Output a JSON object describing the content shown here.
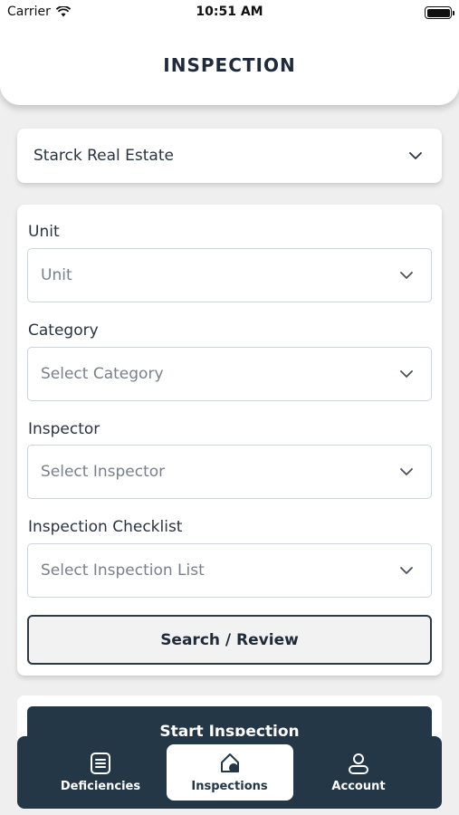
{
  "status_bar": {
    "carrier": "Carrier",
    "time": "10:51 AM"
  },
  "header": {
    "title": "INSPECTION"
  },
  "company_select": {
    "value": "Starck Real Estate"
  },
  "form": {
    "unit": {
      "label": "Unit",
      "placeholder": "Unit"
    },
    "category": {
      "label": "Category",
      "placeholder": "Select Category"
    },
    "inspector": {
      "label": "Inspector",
      "placeholder": "Select Inspector"
    },
    "checklist": {
      "label": "Inspection Checklist",
      "placeholder": "Select Inspection List"
    },
    "search_button": "Search / Review"
  },
  "start_button": "Start Inspection",
  "tabbar": {
    "items": [
      {
        "label": "Deficiencies",
        "icon": "checklist-icon",
        "active": false
      },
      {
        "label": "Inspections",
        "icon": "home-icon",
        "active": true
      },
      {
        "label": "Account",
        "icon": "user-icon",
        "active": false
      }
    ]
  },
  "colors": {
    "primary": "#243746",
    "background": "#efefef",
    "card": "#ffffff",
    "placeholder": "#7a7f8c"
  }
}
